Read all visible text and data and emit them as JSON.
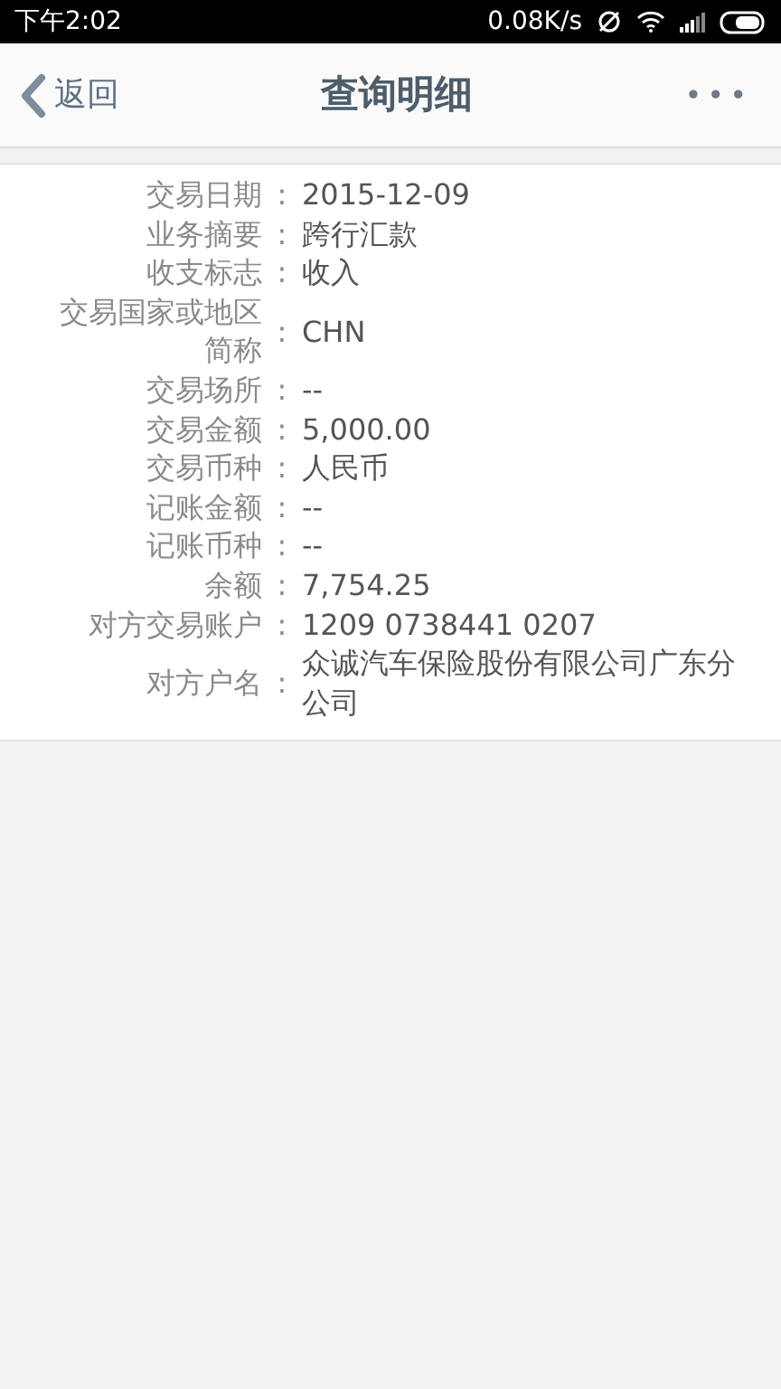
{
  "status_bar": {
    "time": "下午2:02",
    "speed": "0.08K/s"
  },
  "nav_bar": {
    "back": "返回",
    "title": "查询明细",
    "more": "•••"
  },
  "details": [
    {
      "label": "交易日期",
      "colon": ":",
      "value": "2015-12-09"
    },
    {
      "label": "业务摘要",
      "colon": ":",
      "value": "跨行汇款"
    },
    {
      "label": "收支标志",
      "colon": ":",
      "value": "收入"
    },
    {
      "label": "交易国家或地区简称",
      "colon": ":",
      "value": "CHN"
    },
    {
      "label": "交易场所",
      "colon": ":",
      "value": "--"
    },
    {
      "label": "交易金额",
      "colon": ":",
      "value": "5,000.00"
    },
    {
      "label": "交易币种",
      "colon": ":",
      "value": "人民币"
    },
    {
      "label": "记账金额",
      "colon": ":",
      "value": "--"
    },
    {
      "label": "记账币种",
      "colon": ":",
      "value": "--"
    },
    {
      "label": "余额",
      "colon": ":",
      "value": "7,754.25"
    },
    {
      "label": "对方交易账户",
      "colon": ":",
      "value": "1209 0738441 0207"
    },
    {
      "label": "对方户名",
      "colon": ":",
      "value": "众诚汽车保险股份有限公司广东分公司"
    }
  ]
}
